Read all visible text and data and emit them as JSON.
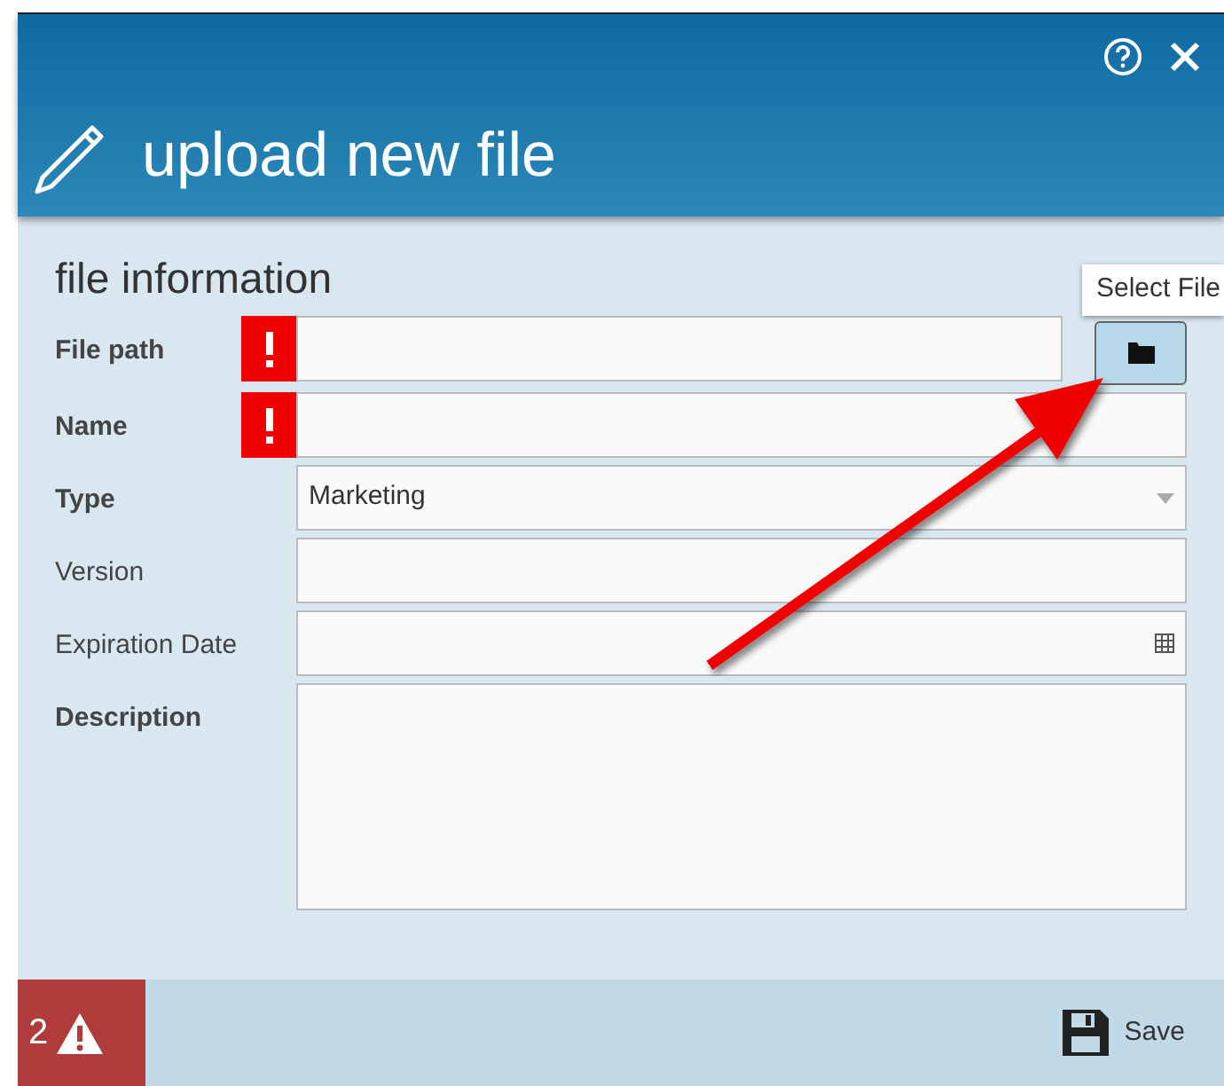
{
  "dialog": {
    "title": "upload new file"
  },
  "section": {
    "title": "file information"
  },
  "fields": [
    {
      "label": "File path",
      "kind": "file",
      "emphasized": true,
      "error": true
    },
    {
      "label": "Name",
      "kind": "text",
      "emphasized": true,
      "error": true
    },
    {
      "label": "Type",
      "kind": "select",
      "emphasized": true,
      "error": false,
      "value": "Marketing"
    },
    {
      "label": "Version",
      "kind": "text",
      "emphasized": false,
      "error": false
    },
    {
      "label": "Expiration Date",
      "kind": "date",
      "emphasized": false,
      "error": false
    },
    {
      "label": "Description",
      "kind": "textarea",
      "emphasized": true,
      "error": false
    }
  ],
  "tooltip": {
    "text": "Select File"
  },
  "footer": {
    "error_count": "2",
    "save_label": "Save"
  }
}
